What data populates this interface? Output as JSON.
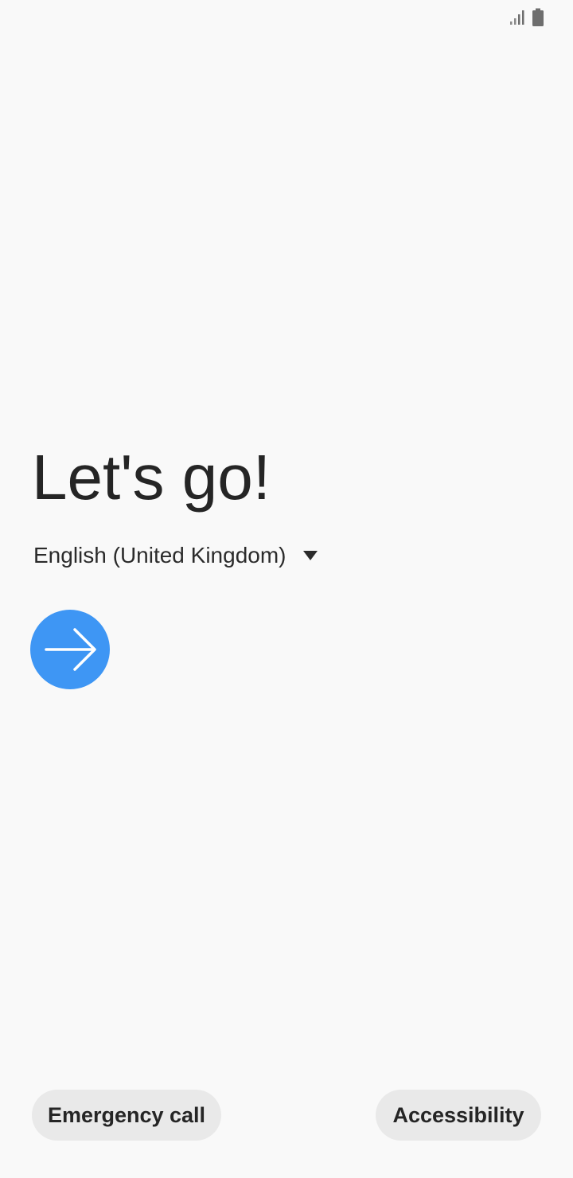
{
  "status_bar": {
    "signal_icon": "signal-bars-icon",
    "battery_icon": "battery-icon"
  },
  "welcome": {
    "title": "Let's go!"
  },
  "language": {
    "selected": "English (United Kingdom)",
    "dropdown_icon": "triangle-down-icon"
  },
  "next": {
    "icon": "arrow-right-icon",
    "color": "#3e96f4"
  },
  "footer": {
    "emergency_label": "Emergency call",
    "accessibility_label": "Accessibility"
  }
}
